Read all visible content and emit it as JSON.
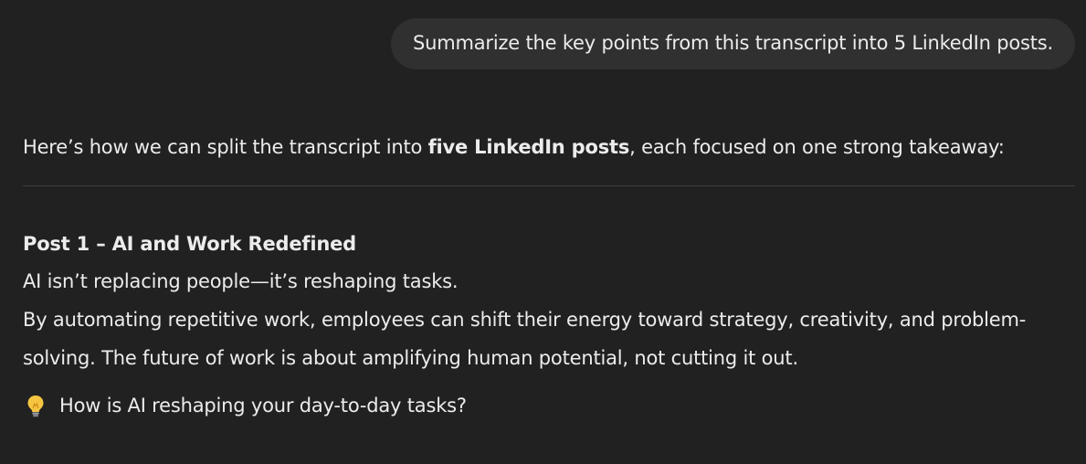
{
  "conversation": {
    "user_message": "Summarize the key points from this transcript into 5 LinkedIn posts.",
    "assistant": {
      "intro_before": "Here’s how we can split the transcript into ",
      "intro_bold": "five LinkedIn posts",
      "intro_after": ", each focused on one strong takeaway:",
      "post1": {
        "title": "Post 1 – AI and Work Redefined",
        "line1": "AI isn’t replacing people—it’s reshaping tasks.",
        "line2": "By automating repetitive work, employees can shift their energy toward strategy, creativity, and problem-solving. The future of work is about amplifying human potential, not cutting it out.",
        "question_icon": "lightbulb-icon",
        "question": "How is AI reshaping your day-to-day tasks?"
      }
    }
  },
  "colors": {
    "background": "#212121",
    "user_bubble": "#303030",
    "text": "#ececec",
    "divider": "#3d3d3d",
    "bulb": "#f5c542"
  }
}
